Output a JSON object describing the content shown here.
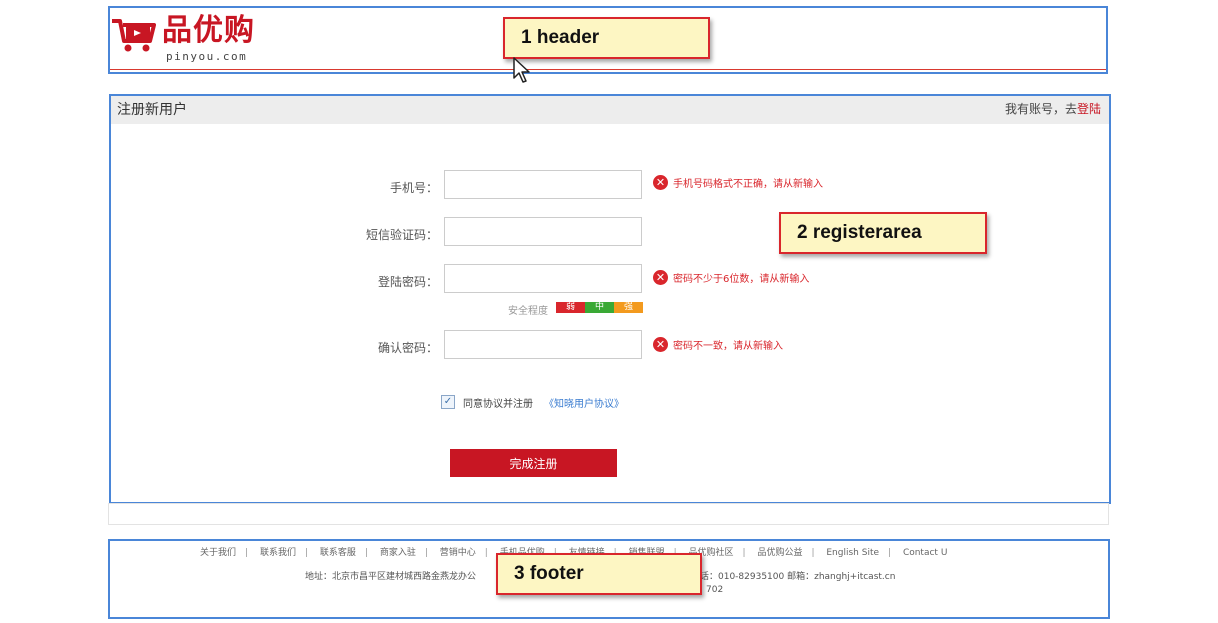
{
  "header": {
    "logo_text": "品优购",
    "logo_sub": "pinyou.com"
  },
  "callouts": {
    "header": "1  header",
    "register": "2  registerarea",
    "footer": "3 footer"
  },
  "register": {
    "title": "注册新用户",
    "login_prefix": "我有账号，去",
    "login_link": "登陆",
    "fields": [
      {
        "label": "手机号：",
        "value": "",
        "error": "手机号码格式不正确，请从新输入"
      },
      {
        "label": "短信验证码：",
        "value": "",
        "error": ""
      },
      {
        "label": "登陆密码：",
        "value": "",
        "error": "密码不少于6位数，请从新输入"
      },
      {
        "label": "确认密码：",
        "value": "",
        "error": "密码不一致，请从新输入"
      }
    ],
    "strength": {
      "label": "安全程度",
      "levels": [
        "弱",
        "中",
        "强"
      ],
      "colors": [
        "#d9262c",
        "#3aa935",
        "#f39a1e"
      ]
    },
    "agree_text": "同意协议并注册",
    "agree_checked": true,
    "agree_link": "《知晓用户协议》",
    "submit": "完成注册",
    "accent_color": "#c81623"
  },
  "footer": {
    "links": [
      "关于我们",
      "联系我们",
      "联系客服",
      "商家入驻",
      "营销中心",
      "手机品优购",
      "友情链接",
      "销售联盟",
      "品优购社区",
      "品优购公益",
      "English Site",
      "Contact U"
    ],
    "address": "地址：北京市昌平区建材城西路金燕龙办公",
    "phone": "话：010-82935100 邮箱：zhanghj+itcast.cn",
    "icp": "702"
  }
}
